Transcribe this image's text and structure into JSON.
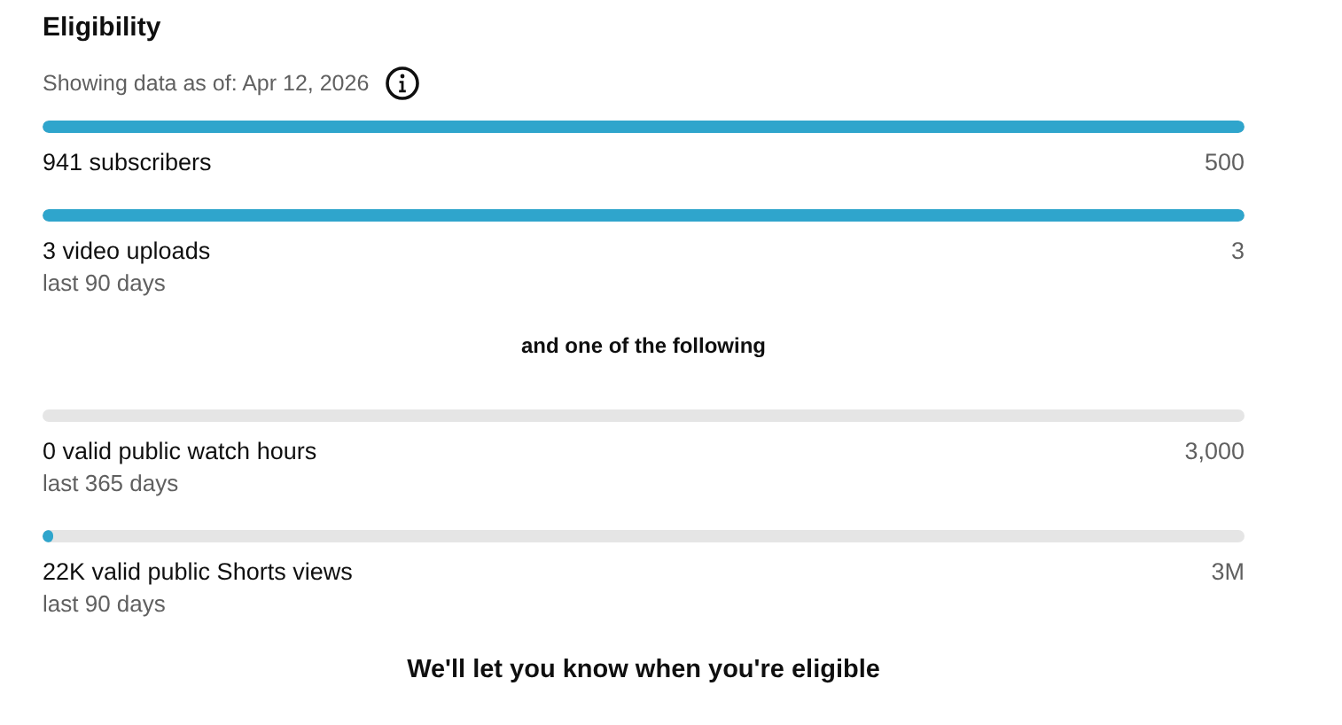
{
  "title": "Eligibility",
  "as_of": "Showing data as of: Apr 12, 2026",
  "required": [
    {
      "label": "941 subscribers",
      "target": "500",
      "level": 1
    },
    {
      "label": "3 video uploads",
      "period": "last 90 days",
      "target": "3",
      "level": 1
    }
  ],
  "connector": "and one of the following",
  "optional": [
    {
      "label": "0 valid public watch hours",
      "period": "last 365 days",
      "target": "3,000"
    },
    {
      "label": "22K valid public Shorts views",
      "period": "last 90 days",
      "target": "3M",
      "level": 0.01
    }
  ],
  "footer": "We'll let you know when you're eligible"
}
